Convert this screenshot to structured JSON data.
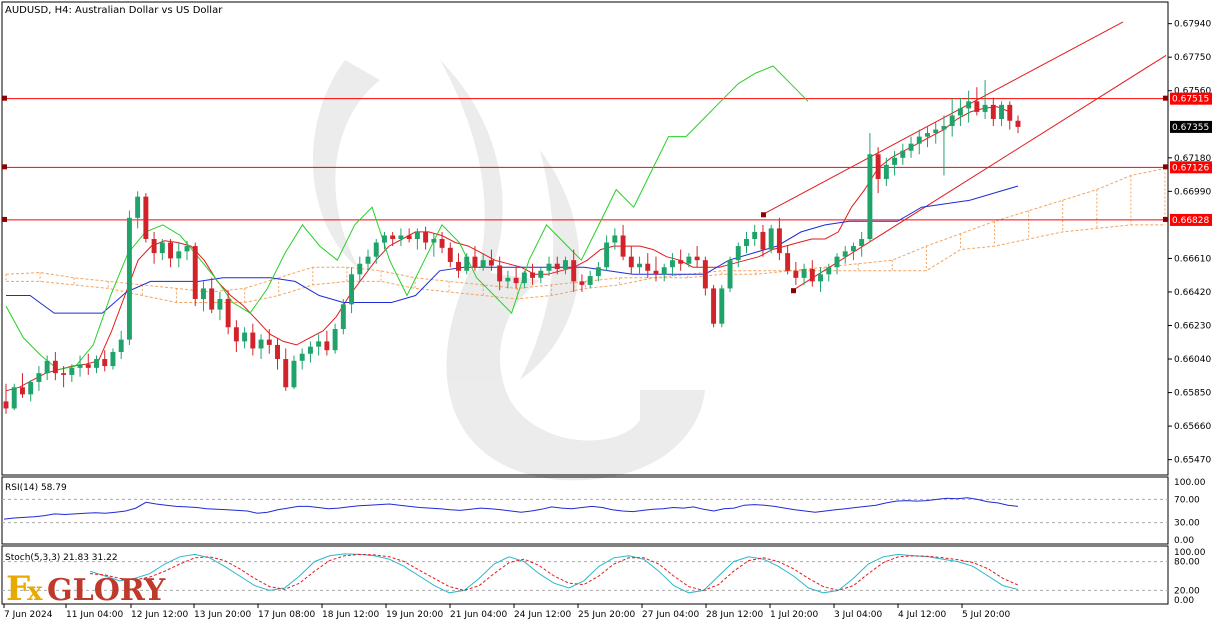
{
  "chart_data": {
    "type": "candlestick",
    "title": "AUDUSD, H4:  Australian Dollar vs US Dollar",
    "symbol": "AUDUSD",
    "timeframe": "H4",
    "ylim": [
      0.654,
      0.6804
    ],
    "y_ticks": [
      "0.67940",
      "0.67750",
      "0.67560",
      "0.67180",
      "0.66990",
      "0.66610",
      "0.66420",
      "0.66230",
      "0.66040",
      "0.65850",
      "0.65660",
      "0.65470"
    ],
    "x_ticks": [
      "7 Jun 2024",
      "11 Jun 04:00",
      "12 Jun 12:00",
      "13 Jun 20:00",
      "17 Jun 08:00",
      "18 Jun 12:00",
      "19 Jun 20:00",
      "21 Jun 04:00",
      "24 Jun 12:00",
      "25 Jun 20:00",
      "27 Jun 04:00",
      "28 Jun 12:00",
      "1 Jul 20:00",
      "3 Jul 04:00",
      "4 Jul 12:00",
      "5 Jul 20:00"
    ],
    "current_price": "0.67355",
    "price_tags": [
      {
        "label": "0.67515",
        "value": 0.67515,
        "color": "#ff0000"
      },
      {
        "label": "0.67126",
        "value": 0.67126,
        "color": "#ff0000"
      },
      {
        "label": "0.66828",
        "value": 0.66828,
        "color": "#ff0000"
      }
    ],
    "horizontal_levels": [
      0.67515,
      0.67126,
      0.66828
    ],
    "candles_ohlc": [
      [
        0.658,
        0.659,
        0.6573,
        0.6576
      ],
      [
        0.6576,
        0.659,
        0.6575,
        0.6588
      ],
      [
        0.6588,
        0.6596,
        0.6582,
        0.6584
      ],
      [
        0.6584,
        0.6592,
        0.658,
        0.6591
      ],
      [
        0.6591,
        0.66,
        0.6586,
        0.6596
      ],
      [
        0.6596,
        0.6606,
        0.6592,
        0.6603
      ],
      [
        0.6603,
        0.6608,
        0.6592,
        0.6596
      ],
      [
        0.6596,
        0.66,
        0.6588,
        0.6595
      ],
      [
        0.6595,
        0.6601,
        0.6591,
        0.6599
      ],
      [
        0.6599,
        0.6606,
        0.6594,
        0.6601
      ],
      [
        0.6601,
        0.6607,
        0.6595,
        0.6599
      ],
      [
        0.6599,
        0.6606,
        0.6596,
        0.6604
      ],
      [
        0.6604,
        0.6609,
        0.6597,
        0.66
      ],
      [
        0.66,
        0.661,
        0.6598,
        0.6608
      ],
      [
        0.6608,
        0.662,
        0.6604,
        0.6615
      ],
      [
        0.6615,
        0.6688,
        0.6612,
        0.6684
      ],
      [
        0.6684,
        0.6699,
        0.6678,
        0.6696
      ],
      [
        0.6696,
        0.6698,
        0.667,
        0.6672
      ],
      [
        0.6672,
        0.6676,
        0.6658,
        0.6664
      ],
      [
        0.6664,
        0.6672,
        0.666,
        0.667
      ],
      [
        0.667,
        0.6672,
        0.6656,
        0.6661
      ],
      [
        0.6661,
        0.667,
        0.6656,
        0.6665
      ],
      [
        0.6665,
        0.6671,
        0.666,
        0.6668
      ],
      [
        0.6668,
        0.667,
        0.6634,
        0.6638
      ],
      [
        0.6638,
        0.6648,
        0.6631,
        0.6644
      ],
      [
        0.6644,
        0.665,
        0.663,
        0.6632
      ],
      [
        0.6632,
        0.6642,
        0.6626,
        0.6638
      ],
      [
        0.6638,
        0.6643,
        0.6618,
        0.6622
      ],
      [
        0.6622,
        0.6626,
        0.6608,
        0.6614
      ],
      [
        0.6614,
        0.6622,
        0.661,
        0.6619
      ],
      [
        0.6619,
        0.6624,
        0.6606,
        0.661
      ],
      [
        0.661,
        0.6618,
        0.6604,
        0.6615
      ],
      [
        0.6615,
        0.6621,
        0.6607,
        0.6612
      ],
      [
        0.6612,
        0.6616,
        0.6598,
        0.6604
      ],
      [
        0.6604,
        0.661,
        0.6586,
        0.6588
      ],
      [
        0.6588,
        0.6606,
        0.6587,
        0.6603
      ],
      [
        0.6603,
        0.661,
        0.6598,
        0.6607
      ],
      [
        0.6607,
        0.6614,
        0.6602,
        0.6611
      ],
      [
        0.6611,
        0.6618,
        0.6606,
        0.6614
      ],
      [
        0.6614,
        0.662,
        0.6606,
        0.6609
      ],
      [
        0.6609,
        0.6624,
        0.6607,
        0.6621
      ],
      [
        0.6621,
        0.6638,
        0.6618,
        0.6635
      ],
      [
        0.6635,
        0.6656,
        0.663,
        0.6652
      ],
      [
        0.6652,
        0.6662,
        0.6648,
        0.6658
      ],
      [
        0.6658,
        0.6666,
        0.6654,
        0.6662
      ],
      [
        0.6662,
        0.6672,
        0.6658,
        0.667
      ],
      [
        0.667,
        0.6676,
        0.6666,
        0.6674
      ],
      [
        0.6674,
        0.6676,
        0.6668,
        0.6672
      ],
      [
        0.6672,
        0.6678,
        0.6668,
        0.6674
      ],
      [
        0.6674,
        0.6678,
        0.667,
        0.6672
      ],
      [
        0.6672,
        0.6678,
        0.6666,
        0.6676
      ],
      [
        0.6676,
        0.6679,
        0.6666,
        0.667
      ],
      [
        0.667,
        0.6675,
        0.6662,
        0.6672
      ],
      [
        0.6672,
        0.6676,
        0.6664,
        0.6667
      ],
      [
        0.6667,
        0.667,
        0.6656,
        0.6659
      ],
      [
        0.6659,
        0.6664,
        0.665,
        0.6654
      ],
      [
        0.6654,
        0.6664,
        0.6652,
        0.6662
      ],
      [
        0.6662,
        0.6668,
        0.6654,
        0.6656
      ],
      [
        0.6656,
        0.6664,
        0.6654,
        0.666
      ],
      [
        0.666,
        0.6666,
        0.6654,
        0.6657
      ],
      [
        0.6657,
        0.6662,
        0.6643,
        0.6648
      ],
      [
        0.6648,
        0.6654,
        0.6644,
        0.665
      ],
      [
        0.665,
        0.6656,
        0.6644,
        0.6647
      ],
      [
        0.6647,
        0.6654,
        0.6644,
        0.6653
      ],
      [
        0.6653,
        0.6658,
        0.6646,
        0.665
      ],
      [
        0.665,
        0.6656,
        0.6647,
        0.6654
      ],
      [
        0.6654,
        0.6662,
        0.6651,
        0.6658
      ],
      [
        0.6658,
        0.6662,
        0.6652,
        0.6655
      ],
      [
        0.6655,
        0.6662,
        0.6652,
        0.666
      ],
      [
        0.666,
        0.6666,
        0.6642,
        0.6648
      ],
      [
        0.6648,
        0.6652,
        0.6642,
        0.6646
      ],
      [
        0.6646,
        0.6654,
        0.6644,
        0.6651
      ],
      [
        0.6651,
        0.6659,
        0.6648,
        0.6656
      ],
      [
        0.6656,
        0.6674,
        0.6654,
        0.667
      ],
      [
        0.667,
        0.6678,
        0.6666,
        0.6674
      ],
      [
        0.6674,
        0.668,
        0.666,
        0.6662
      ],
      [
        0.6662,
        0.6668,
        0.6652,
        0.6656
      ],
      [
        0.6656,
        0.6662,
        0.6652,
        0.6658
      ],
      [
        0.6658,
        0.6664,
        0.665,
        0.6654
      ],
      [
        0.6654,
        0.6662,
        0.6648,
        0.6652
      ],
      [
        0.6652,
        0.6658,
        0.6648,
        0.6656
      ],
      [
        0.6656,
        0.6664,
        0.6651,
        0.666
      ],
      [
        0.666,
        0.6666,
        0.6654,
        0.6658
      ],
      [
        0.6658,
        0.6664,
        0.6656,
        0.6662
      ],
      [
        0.6662,
        0.6668,
        0.6656,
        0.666
      ],
      [
        0.666,
        0.6662,
        0.664,
        0.6644
      ],
      [
        0.6644,
        0.6646,
        0.6622,
        0.6624
      ],
      [
        0.6624,
        0.6646,
        0.6622,
        0.6644
      ],
      [
        0.6644,
        0.6662,
        0.6642,
        0.666
      ],
      [
        0.666,
        0.667,
        0.6656,
        0.6668
      ],
      [
        0.6668,
        0.6676,
        0.6664,
        0.6672
      ],
      [
        0.6672,
        0.668,
        0.6668,
        0.6676
      ],
      [
        0.6676,
        0.668,
        0.6662,
        0.6666
      ],
      [
        0.6666,
        0.668,
        0.6664,
        0.6678
      ],
      [
        0.6678,
        0.6684,
        0.666,
        0.6664
      ],
      [
        0.6664,
        0.6668,
        0.6652,
        0.6654
      ],
      [
        0.6654,
        0.6659,
        0.6646,
        0.665
      ],
      [
        0.665,
        0.6658,
        0.6646,
        0.6655
      ],
      [
        0.6655,
        0.666,
        0.6645,
        0.6648
      ],
      [
        0.6648,
        0.6656,
        0.6642,
        0.6652
      ],
      [
        0.6652,
        0.6658,
        0.6648,
        0.6656
      ],
      [
        0.6656,
        0.6664,
        0.6652,
        0.6662
      ],
      [
        0.6662,
        0.6668,
        0.6658,
        0.6665
      ],
      [
        0.6665,
        0.667,
        0.666,
        0.6668
      ],
      [
        0.6668,
        0.6676,
        0.6662,
        0.6672
      ],
      [
        0.6672,
        0.6732,
        0.667,
        0.672
      ],
      [
        0.672,
        0.6724,
        0.6698,
        0.6706
      ],
      [
        0.6706,
        0.6718,
        0.6702,
        0.6714
      ],
      [
        0.6714,
        0.6722,
        0.6708,
        0.6718
      ],
      [
        0.6718,
        0.6726,
        0.6714,
        0.6722
      ],
      [
        0.6722,
        0.673,
        0.6718,
        0.6726
      ],
      [
        0.6726,
        0.6734,
        0.672,
        0.673
      ],
      [
        0.673,
        0.6736,
        0.6724,
        0.6732
      ],
      [
        0.6732,
        0.6738,
        0.6726,
        0.6734
      ],
      [
        0.6734,
        0.6742,
        0.6708,
        0.6736
      ],
      [
        0.6736,
        0.6752,
        0.673,
        0.6742
      ],
      [
        0.6742,
        0.6752,
        0.6736,
        0.6746
      ],
      [
        0.6746,
        0.6756,
        0.6738,
        0.675
      ],
      [
        0.675,
        0.6758,
        0.6742,
        0.6744
      ],
      [
        0.6744,
        0.6762,
        0.674,
        0.6748
      ],
      [
        0.6748,
        0.6752,
        0.6736,
        0.674
      ],
      [
        0.674,
        0.675,
        0.6736,
        0.6748
      ],
      [
        0.6748,
        0.675,
        0.6734,
        0.6739
      ],
      [
        0.6739,
        0.6742,
        0.6732,
        0.67355
      ]
    ],
    "tenkan_sen_red": [
      0.6586,
      0.6588,
      0.6592,
      0.6596,
      0.6598,
      0.66,
      0.6601,
      0.6603,
      0.662,
      0.664,
      0.666,
      0.6668,
      0.6671,
      0.667,
      0.6668,
      0.666,
      0.6648,
      0.664,
      0.6634,
      0.6626,
      0.6618,
      0.6614,
      0.6612,
      0.6616,
      0.662,
      0.6628,
      0.664,
      0.665,
      0.666,
      0.6668,
      0.6672,
      0.6676,
      0.6676,
      0.6674,
      0.667,
      0.6668,
      0.6664,
      0.666,
      0.6658,
      0.6656,
      0.6652,
      0.6652,
      0.6654,
      0.6656,
      0.666,
      0.6666,
      0.6668,
      0.6668,
      0.6668,
      0.6666,
      0.6662,
      0.666,
      0.6656,
      0.6656,
      0.6656,
      0.6658,
      0.666,
      0.6662,
      0.6666,
      0.6668,
      0.667,
      0.6672,
      0.6672,
      0.6676,
      0.669,
      0.67,
      0.6712,
      0.6718,
      0.6722,
      0.6726,
      0.673,
      0.6734,
      0.674,
      0.6744,
      0.6746,
      0.6747,
      0.6744
    ],
    "kijun_sen_blue": [
      0.664,
      0.664,
      0.663,
      0.663,
      0.663,
      0.6642,
      0.6648,
      0.6648,
      0.6648,
      0.665,
      0.665,
      0.665,
      0.6648,
      0.664,
      0.6636,
      0.6636,
      0.6636,
      0.664,
      0.6654,
      0.6656,
      0.6656,
      0.6656,
      0.6656,
      0.6656,
      0.6656,
      0.6654,
      0.6652,
      0.6652,
      0.6652,
      0.6652,
      0.666,
      0.6664,
      0.6668,
      0.6676,
      0.668,
      0.6682,
      0.6682,
      0.6682,
      0.669,
      0.6692,
      0.6694,
      0.6698,
      0.6702
    ],
    "chikou_span_green": [
      0.6634,
      0.6616,
      0.6606,
      0.6598,
      0.66,
      0.6612,
      0.664,
      0.6664,
      0.6676,
      0.668,
      0.6674,
      0.6662,
      0.665,
      0.6636,
      0.663,
      0.6644,
      0.6664,
      0.668,
      0.6668,
      0.666,
      0.668,
      0.669,
      0.666,
      0.664,
      0.666,
      0.668,
      0.667,
      0.665,
      0.664,
      0.663,
      0.666,
      0.668,
      0.667,
      0.666,
      0.668,
      0.67,
      0.669,
      0.671,
      0.673,
      0.673,
      0.674,
      0.675,
      0.676,
      0.6766,
      0.677,
      0.676,
      0.675
    ],
    "senkou_span_a": [
      0.6652,
      0.6653,
      0.665,
      0.6648,
      0.6646,
      0.6644,
      0.6642,
      0.6644,
      0.665,
      0.6656,
      0.6656,
      0.6654,
      0.665,
      0.6648,
      0.6646,
      0.6644,
      0.6646,
      0.6648,
      0.665,
      0.665,
      0.665,
      0.6652,
      0.6652,
      0.6654,
      0.6656,
      0.6658,
      0.666,
      0.6668,
      0.6675,
      0.6682,
      0.6688,
      0.6694,
      0.67,
      0.6708,
      0.6712
    ],
    "senkou_span_b": [
      0.6648,
      0.6648,
      0.6646,
      0.6644,
      0.664,
      0.6636,
      0.6636,
      0.6636,
      0.664,
      0.6646,
      0.6648,
      0.6648,
      0.6644,
      0.6642,
      0.664,
      0.6638,
      0.664,
      0.6644,
      0.6646,
      0.665,
      0.6652,
      0.6654,
      0.6654,
      0.6654,
      0.6654,
      0.6654,
      0.6654,
      0.6654,
      0.6666,
      0.6668,
      0.6672,
      0.6676,
      0.6678,
      0.668,
      0.668
    ],
    "trend_channel": {
      "lower_line": [
        [
          0.6643,
          "1 Jul 20:00"
        ],
        [
          0.6776,
          "end"
        ]
      ],
      "upper_line": [
        [
          0.6686,
          "1 Jul 20:00"
        ],
        [
          0.6795,
          "end"
        ]
      ]
    },
    "rsi": {
      "label": "RSI(14) 58.79",
      "value": 58.79,
      "ylim": [
        0,
        100
      ],
      "ticks": [
        "100.00",
        "70.00",
        "30.00",
        "0.00"
      ],
      "levels": [
        70,
        30
      ],
      "values": [
        36,
        38,
        39,
        40,
        42,
        45,
        44,
        45,
        46,
        47,
        46,
        48,
        50,
        55,
        65,
        62,
        60,
        58,
        57,
        56,
        54,
        53,
        52,
        51,
        50,
        46,
        48,
        52,
        55,
        58,
        58,
        56,
        54,
        55,
        57,
        59,
        60,
        61,
        62,
        60,
        58,
        56,
        55,
        54,
        52,
        51,
        53,
        55,
        54,
        52,
        50,
        48,
        50,
        53,
        57,
        55,
        54,
        56,
        58,
        56,
        52,
        50,
        49,
        51,
        53,
        54,
        56,
        55,
        57,
        53,
        50,
        54,
        55,
        60,
        61,
        60,
        58,
        55,
        52,
        50,
        48,
        50,
        52,
        54,
        56,
        58,
        60,
        64,
        67,
        68,
        67,
        68,
        70,
        72,
        71,
        73,
        70,
        66,
        64,
        60,
        58
      ]
    },
    "stochastic": {
      "label": "Stoch(5,3,3) 21.83 31.22",
      "ylim": [
        0,
        100
      ],
      "ticks": [
        "100.00",
        "80.00",
        "20.00",
        "0.00"
      ],
      "levels": [
        80,
        20
      ],
      "k_values": [
        60,
        50,
        40,
        45,
        55,
        75,
        90,
        95,
        88,
        70,
        50,
        30,
        20,
        25,
        50,
        80,
        92,
        96,
        95,
        92,
        85,
        70,
        50,
        30,
        15,
        20,
        45,
        75,
        90,
        80,
        55,
        35,
        25,
        40,
        70,
        88,
        92,
        85,
        60,
        30,
        15,
        20,
        50,
        80,
        90,
        85,
        70,
        50,
        25,
        15,
        20,
        45,
        75,
        90,
        95,
        92,
        90,
        85,
        80,
        70,
        50,
        30,
        21.83
      ],
      "d_values": [
        55,
        52,
        45,
        42,
        48,
        60,
        75,
        88,
        90,
        82,
        65,
        45,
        28,
        22,
        35,
        60,
        82,
        92,
        95,
        94,
        90,
        80,
        62,
        45,
        28,
        20,
        30,
        55,
        78,
        85,
        72,
        50,
        35,
        32,
        50,
        75,
        88,
        88,
        75,
        50,
        28,
        20,
        32,
        60,
        82,
        88,
        80,
        65,
        45,
        28,
        20,
        30,
        55,
        78,
        90,
        92,
        91,
        88,
        84,
        78,
        65,
        45,
        31.22
      ]
    }
  },
  "branding": {
    "logo_text": "FxGlory",
    "logo_color_fx": "#e8a900",
    "logo_color_glory": "#c0392b"
  },
  "colors": {
    "bull": "#1fa36a",
    "bear": "#d2232a",
    "level_line": "#ff0000",
    "tenkan": "#e31a1c",
    "kijun": "#1f2bd6",
    "chikou": "#27d027",
    "cloud": "#f4a460",
    "rsi_line": "#1f2bd6",
    "stoch_k": "#2bb8c8",
    "stoch_d": "#e31a1c"
  }
}
